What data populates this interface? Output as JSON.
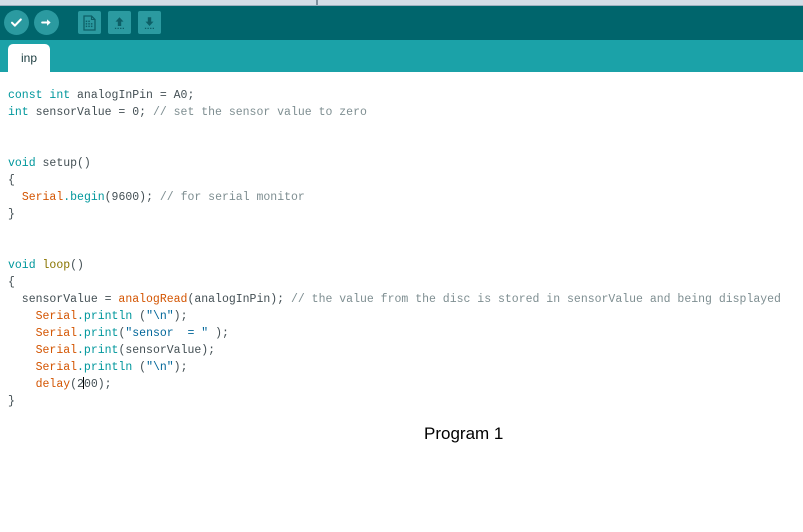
{
  "window": {
    "top_strip": ""
  },
  "toolbar": {
    "background": "#00656c",
    "buttons": [
      {
        "name": "verify-button",
        "icon": "check-icon",
        "label": "Verify"
      },
      {
        "name": "upload-button",
        "icon": "arrow-right-icon",
        "label": "Upload"
      },
      {
        "name": "new-button",
        "icon": "new-document-icon",
        "label": "New"
      },
      {
        "name": "open-button",
        "icon": "arrow-up-icon",
        "label": "Open"
      },
      {
        "name": "save-button",
        "icon": "arrow-down-icon",
        "label": "Save"
      }
    ]
  },
  "tabbar": {
    "background": "#1ba2a8",
    "tabs": [
      {
        "label": "inp",
        "active": true
      }
    ]
  },
  "editor": {
    "caret_line": "delay(200);",
    "lines": [
      {
        "n": 1,
        "tokens": [
          {
            "t": "const ",
            "c": "t-kw"
          },
          {
            "t": "int ",
            "c": "t-kw"
          },
          {
            "t": "analogInPin = A0;",
            "c": "t-pl"
          }
        ]
      },
      {
        "n": 2,
        "tokens": [
          {
            "t": "int ",
            "c": "t-kw"
          },
          {
            "t": "sensorValue = 0; ",
            "c": "t-pl"
          },
          {
            "t": "// set the sensor value to zero",
            "c": "t-com"
          }
        ]
      },
      {
        "n": 3,
        "tokens": []
      },
      {
        "n": 4,
        "tokens": []
      },
      {
        "n": 5,
        "tokens": [
          {
            "t": "void ",
            "c": "t-kw"
          },
          {
            "t": "setup",
            "c": "t-name"
          },
          {
            "t": "()",
            "c": "t-pl"
          }
        ]
      },
      {
        "n": 6,
        "tokens": [
          {
            "t": "{",
            "c": "t-pl"
          }
        ]
      },
      {
        "n": 7,
        "tokens": [
          {
            "t": "  ",
            "c": "t-pl"
          },
          {
            "t": "Serial",
            "c": "t-fn"
          },
          {
            "t": ".begin",
            "c": "t-mem"
          },
          {
            "t": "(9600); ",
            "c": "t-pl"
          },
          {
            "t": "// for serial monitor",
            "c": "t-com"
          }
        ]
      },
      {
        "n": 8,
        "tokens": [
          {
            "t": "}",
            "c": "t-pl"
          }
        ]
      },
      {
        "n": 9,
        "tokens": []
      },
      {
        "n": 10,
        "tokens": []
      },
      {
        "n": 11,
        "tokens": [
          {
            "t": "void ",
            "c": "t-kw"
          },
          {
            "t": "loop",
            "c": "t-loop"
          },
          {
            "t": "()",
            "c": "t-pl"
          }
        ]
      },
      {
        "n": 12,
        "tokens": [
          {
            "t": "{",
            "c": "t-pl"
          }
        ]
      },
      {
        "n": 13,
        "tokens": [
          {
            "t": "  sensorValue = ",
            "c": "t-pl"
          },
          {
            "t": "analogRead",
            "c": "t-fn"
          },
          {
            "t": "(analogInPin); ",
            "c": "t-pl"
          },
          {
            "t": "// the value from the disc is stored in sensorValue and being displayed",
            "c": "t-com"
          }
        ]
      },
      {
        "n": 14,
        "tokens": [
          {
            "t": "    ",
            "c": "t-pl"
          },
          {
            "t": "Serial",
            "c": "t-fn"
          },
          {
            "t": ".println",
            "c": "t-mem"
          },
          {
            "t": " (",
            "c": "t-pl"
          },
          {
            "t": "\"\\n\"",
            "c": "t-str"
          },
          {
            "t": ");",
            "c": "t-pl"
          }
        ]
      },
      {
        "n": 15,
        "tokens": [
          {
            "t": "    ",
            "c": "t-pl"
          },
          {
            "t": "Serial",
            "c": "t-fn"
          },
          {
            "t": ".print",
            "c": "t-mem"
          },
          {
            "t": "(",
            "c": "t-pl"
          },
          {
            "t": "\"sensor  = \"",
            "c": "t-str"
          },
          {
            "t": " );",
            "c": "t-pl"
          }
        ]
      },
      {
        "n": 16,
        "tokens": [
          {
            "t": "    ",
            "c": "t-pl"
          },
          {
            "t": "Serial",
            "c": "t-fn"
          },
          {
            "t": ".print",
            "c": "t-mem"
          },
          {
            "t": "(sensorValue);",
            "c": "t-pl"
          }
        ]
      },
      {
        "n": 17,
        "tokens": [
          {
            "t": "    ",
            "c": "t-pl"
          },
          {
            "t": "Serial",
            "c": "t-fn"
          },
          {
            "t": ".println",
            "c": "t-mem"
          },
          {
            "t": " (",
            "c": "t-pl"
          },
          {
            "t": "\"\\n\"",
            "c": "t-str"
          },
          {
            "t": ");",
            "c": "t-pl"
          }
        ]
      },
      {
        "n": 18,
        "tokens": [
          {
            "t": "    ",
            "c": "t-pl"
          },
          {
            "t": "delay",
            "c": "t-fn"
          },
          {
            "t": "(2",
            "c": "t-pl"
          },
          {
            "t": "CARET",
            "c": "caret"
          },
          {
            "t": "00);",
            "c": "t-pl"
          }
        ]
      },
      {
        "n": 19,
        "tokens": [
          {
            "t": "}",
            "c": "t-pl"
          }
        ]
      }
    ]
  },
  "caption": {
    "text": "Program 1"
  }
}
